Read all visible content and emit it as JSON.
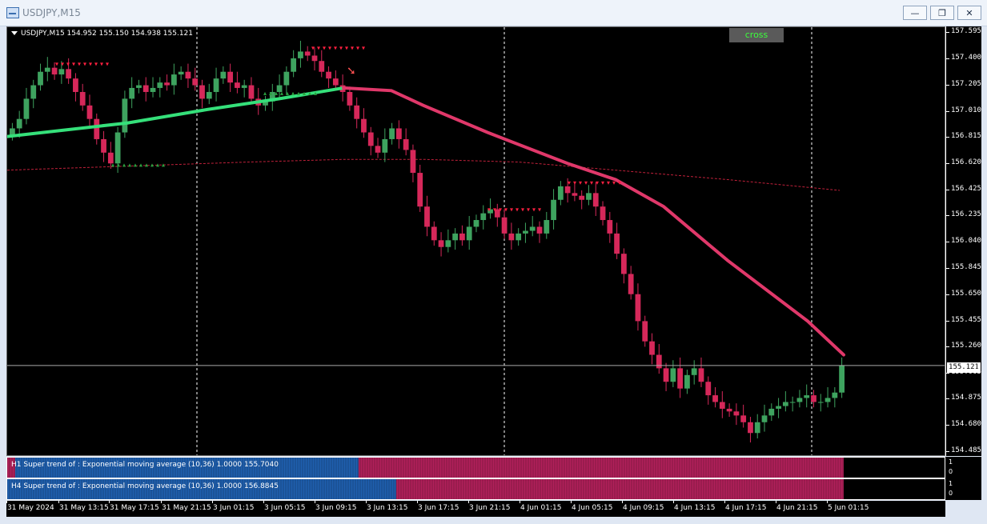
{
  "window": {
    "title": "USDJPY,M15",
    "btn_minimize": "—",
    "btn_restore": "❐",
    "btn_close": "✕"
  },
  "chart": {
    "symbol_info": "USDJPY,M15  154.952 155.150 154.938 155.121",
    "cross_label": "cross",
    "current_price": "155.121",
    "price_levels": [
      "157.595",
      "157.400",
      "157.205",
      "157.010",
      "156.815",
      "156.620",
      "156.425",
      "156.235",
      "156.040",
      "155.845",
      "155.650",
      "155.455",
      "155.260",
      "155.065",
      "154.875",
      "154.680",
      "154.485"
    ],
    "time_labels": [
      "31 May 2024",
      "31 May 13:15",
      "31 May 17:15",
      "31 May 21:15",
      "3 Jun 01:15",
      "3 Jun 05:15",
      "3 Jun 09:15",
      "3 Jun 13:15",
      "3 Jun 17:15",
      "3 Jun 21:15",
      "4 Jun 01:15",
      "4 Jun 05:15",
      "4 Jun 09:15",
      "4 Jun 13:15",
      "4 Jun 17:15",
      "4 Jun 21:15",
      "5 Jun 01:15"
    ]
  },
  "indicators": [
    {
      "label": "H1  Super trend of : Exponential moving average (10,36)  1.0000 155.7040",
      "scale_top": "1",
      "scale_bottom": "0",
      "blue_fraction": 0.42
    },
    {
      "label": "H4  Super trend of : Exponential moving average (10,36)  1.0000 156.8845",
      "scale_top": "1",
      "scale_bottom": "0",
      "blue_fraction": 0.465
    }
  ],
  "chart_data": {
    "type": "candlestick",
    "y_range": [
      154.485,
      157.595
    ],
    "close_series": [
      156.88,
      156.95,
      157.1,
      157.2,
      157.3,
      157.33,
      157.28,
      157.32,
      157.25,
      157.15,
      157.05,
      156.95,
      156.8,
      156.7,
      156.62,
      156.85,
      157.1,
      157.18,
      157.2,
      157.15,
      157.18,
      157.22,
      157.2,
      157.28,
      157.3,
      157.25,
      157.2,
      157.1,
      157.15,
      157.25,
      157.3,
      157.22,
      157.18,
      157.2,
      157.1,
      157.05,
      157.08,
      157.15,
      157.2,
      157.3,
      157.4,
      157.45,
      157.42,
      157.38,
      157.3,
      157.25,
      157.2,
      157.15,
      157.05,
      156.95,
      156.85,
      156.75,
      156.7,
      156.8,
      156.88,
      156.8,
      156.72,
      156.55,
      156.3,
      156.15,
      156.05,
      156.0,
      156.05,
      156.1,
      156.05,
      156.15,
      156.2,
      156.25,
      156.28,
      156.22,
      156.1,
      156.05,
      156.1,
      156.12,
      156.15,
      156.1,
      156.2,
      156.35,
      156.45,
      156.4,
      156.38,
      156.35,
      156.4,
      156.3,
      156.2,
      156.1,
      155.95,
      155.8,
      155.65,
      155.45,
      155.3,
      155.2,
      155.1,
      155.0,
      155.1,
      154.95,
      155.05,
      155.1,
      155.0,
      154.9,
      154.85,
      154.8,
      154.78,
      154.75,
      154.7,
      154.62,
      154.7,
      154.75,
      154.8,
      154.82,
      154.85,
      154.85,
      154.88,
      154.9,
      154.85,
      154.85,
      154.88,
      154.92,
      155.12
    ],
    "ma_slow_points": [
      [
        0,
        156.82
      ],
      [
        60,
        156.86
      ],
      [
        150,
        156.92
      ],
      [
        250,
        157.02
      ],
      [
        340,
        157.1
      ],
      [
        420,
        157.18
      ],
      [
        480,
        157.16
      ],
      [
        520,
        157.05
      ],
      [
        600,
        156.85
      ],
      [
        700,
        156.62
      ],
      [
        760,
        156.5
      ],
      [
        820,
        156.3
      ],
      [
        900,
        155.9
      ],
      [
        1000,
        155.45
      ],
      [
        1045,
        155.2
      ]
    ],
    "ma_dotted_points": [
      [
        0,
        156.57
      ],
      [
        150,
        156.6
      ],
      [
        300,
        156.63
      ],
      [
        420,
        156.65
      ],
      [
        520,
        156.65
      ],
      [
        640,
        156.63
      ],
      [
        760,
        156.57
      ],
      [
        900,
        156.5
      ],
      [
        1040,
        156.42
      ]
    ]
  }
}
